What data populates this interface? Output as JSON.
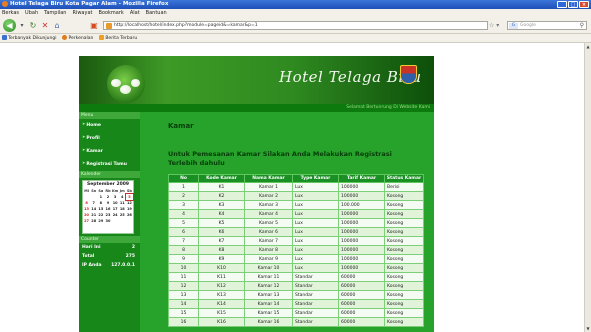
{
  "window": {
    "title": "Hotel Telaga Biru Kota Pagar Alam - Mozilla Firefox",
    "controls": [
      "_",
      "□",
      "×"
    ]
  },
  "menubar": {
    "items": [
      "Berkas",
      "Ubah",
      "Tampilan",
      "Riwayat",
      "Bookmark",
      "Alat",
      "Bantuan"
    ]
  },
  "navbar": {
    "url": "http://localhost/hotel/index.php?module=pageid&=kamar&p=1",
    "search_engine": "G",
    "search_placeholder": "Google"
  },
  "bookmarks": {
    "items": [
      {
        "label": "Terbanyak Dikunjungi",
        "icon": "most-visited-icon",
        "color": "#3d6fd0"
      },
      {
        "label": "Perkenalan",
        "icon": "firefox-icon",
        "color": "#e07b1e"
      },
      {
        "label": "Berita Terbaru",
        "icon": "rss-icon",
        "color": "#f0a020"
      }
    ]
  },
  "site": {
    "title": "Hotel Telaga Biru",
    "greeting": "Selamat Bertunrung Di Website Kami"
  },
  "sidebar": {
    "menu_header": "Menu",
    "menu": [
      "Home",
      "Profil",
      "Kamar",
      "Registrasi Tamu"
    ],
    "calendar_header": "Kalender",
    "calendar": {
      "title": "September 2009",
      "weekdays": [
        "Mi",
        "Sn",
        "Sa",
        "Rb",
        "Km",
        "Jm",
        "Sb"
      ],
      "days": [
        "",
        "",
        "1",
        "2",
        "3",
        "4",
        "5",
        "6",
        "7",
        "8",
        "9",
        "10",
        "11",
        "12",
        "13",
        "14",
        "15",
        "16",
        "17",
        "18",
        "19",
        "20",
        "21",
        "22",
        "23",
        "24",
        "25",
        "26",
        "27",
        "28",
        "29",
        "30",
        "",
        "",
        ""
      ],
      "today": "5"
    },
    "counter_header": "Counter",
    "counter": [
      {
        "label": "Hari Ini",
        "value": "2"
      },
      {
        "label": "Total",
        "value": "275"
      },
      {
        "label": "IP Anda",
        "value": "127.0.0.1"
      }
    ]
  },
  "main": {
    "title": "Kamar",
    "instruction": "Untuk Pemesanan Kamar Silakan Anda Melakukan Registrasi Terlebih dahulu",
    "table": {
      "headers": [
        "No",
        "Kode Kamar",
        "Nama Kamar",
        "Type Kamar",
        "Tarif Kamar",
        "Status Kamar"
      ],
      "rows": [
        [
          "1",
          "K1",
          "Kamar 1",
          "Lux",
          "100000",
          "Berisi"
        ],
        [
          "2",
          "K2",
          "Kamar 2",
          "Lux",
          "100000",
          "Kosong"
        ],
        [
          "3",
          "K3",
          "Kamar 3",
          "Lux",
          "100.000",
          "Kosong"
        ],
        [
          "4",
          "K4",
          "Kamar 4",
          "Lux",
          "100000",
          "Kosong"
        ],
        [
          "5",
          "K5",
          "Kamar 5",
          "Lux",
          "100000",
          "Kosong"
        ],
        [
          "6",
          "K6",
          "Kamar 6",
          "Lux",
          "100000",
          "Kosong"
        ],
        [
          "7",
          "K7",
          "Kamar 7",
          "Lux",
          "100000",
          "Kosong"
        ],
        [
          "8",
          "K8",
          "Kamar 8",
          "Lux",
          "100000",
          "Kosong"
        ],
        [
          "9",
          "K9",
          "Kamar 9",
          "Lux",
          "100000",
          "Kosong"
        ],
        [
          "10",
          "K10",
          "Kamar 10",
          "Lux",
          "100000",
          "Kosong"
        ],
        [
          "11",
          "K11",
          "Kamar 11",
          "Standar",
          "60000",
          "Kosong"
        ],
        [
          "12",
          "K12",
          "Kamar 12",
          "Standar",
          "60000",
          "Kosong"
        ],
        [
          "13",
          "K13",
          "Kamar 13",
          "Standar",
          "60000",
          "Kosong"
        ],
        [
          "14",
          "K14",
          "Kamar 14",
          "Standar",
          "60000",
          "Kosong"
        ],
        [
          "15",
          "K15",
          "Kamar 15",
          "Standar",
          "60000",
          "Kosong"
        ],
        [
          "16",
          "K16",
          "Kamar 16",
          "Standar",
          "60000",
          "Kosong"
        ]
      ]
    }
  }
}
